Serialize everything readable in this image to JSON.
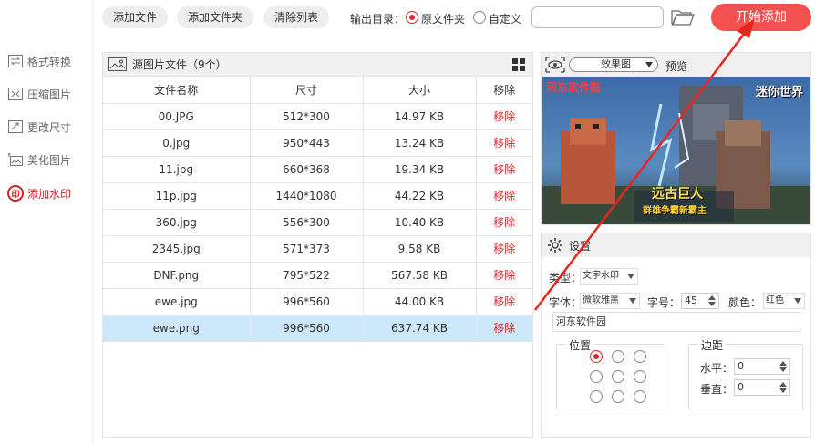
{
  "toolbar": {
    "add_file": "添加文件",
    "add_folder": "添加文件夹",
    "clear_list": "清除列表",
    "output_label": "输出目录：",
    "opt_original": "原文件夹",
    "opt_custom": "自定义",
    "path_value": "",
    "start": "开始添加",
    "accent": "#f3514f"
  },
  "sidebar": {
    "items": [
      {
        "label": "格式转换",
        "icon": "convert-icon"
      },
      {
        "label": "压缩图片",
        "icon": "compress-icon"
      },
      {
        "label": "更改尺寸",
        "icon": "resize-icon"
      },
      {
        "label": "美化图片",
        "icon": "beautify-icon"
      },
      {
        "label": "添加水印",
        "icon": "watermark-icon",
        "active": true,
        "badge": "印"
      }
    ]
  },
  "files": {
    "title": "源图片文件（9个）",
    "columns": [
      "文件名称",
      "尺寸",
      "大小",
      "移除"
    ],
    "rows": [
      {
        "name": "00.JPG",
        "size": "512*300",
        "bytes": "14.97 KB",
        "remove": "移除"
      },
      {
        "name": "0.jpg",
        "size": "950*443",
        "bytes": "13.24 KB",
        "remove": "移除"
      },
      {
        "name": "11.jpg",
        "size": "660*368",
        "bytes": "19.34 KB",
        "remove": "移除"
      },
      {
        "name": "11p.jpg",
        "size": "1440*1080",
        "bytes": "44.22 KB",
        "remove": "移除"
      },
      {
        "name": "360.jpg",
        "size": "556*300",
        "bytes": "10.40 KB",
        "remove": "移除"
      },
      {
        "name": "2345.jpg",
        "size": "571*373",
        "bytes": "9.58 KB",
        "remove": "移除"
      },
      {
        "name": "DNF.png",
        "size": "795*522",
        "bytes": "567.58 KB",
        "remove": "移除"
      },
      {
        "name": "ewe.jpg",
        "size": "996*560",
        "bytes": "44.00 KB",
        "remove": "移除"
      },
      {
        "name": "ewe.png",
        "size": "996*560",
        "bytes": "637.74 KB",
        "remove": "移除"
      }
    ],
    "selected_row": 8
  },
  "preview": {
    "mode": "效果图",
    "label": "预览",
    "watermark_text": "河东软件园",
    "game_logo": "迷你世界",
    "banner_title": "远古巨人",
    "banner_sub": "群雄争霸新霸主"
  },
  "settings": {
    "title": "设置",
    "type_label": "类型：",
    "type_value": "文字水印",
    "font_label": "字体：",
    "font_value": "微软雅黑",
    "fontsize_label": "字号：",
    "fontsize_value": "45",
    "color_label": "颜色：",
    "color_value": "红色",
    "text_value": "河东软件园",
    "position_label": "位置",
    "margin_label": "边距",
    "h_label": "水平：",
    "h_value": "0",
    "v_label": "垂直：",
    "v_value": "0"
  }
}
